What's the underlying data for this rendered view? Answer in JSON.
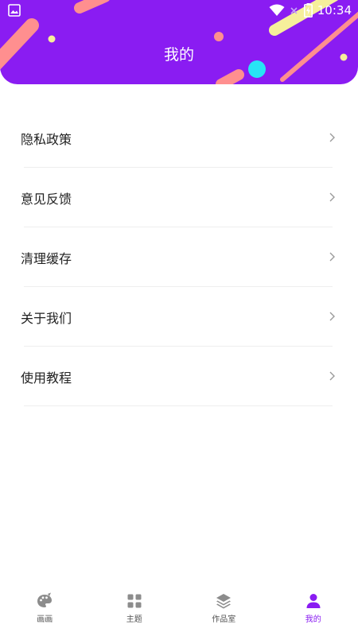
{
  "status_bar": {
    "time": "10:34"
  },
  "header": {
    "title": "我的"
  },
  "menu": {
    "items": [
      {
        "label": "隐私政策"
      },
      {
        "label": "意见反馈"
      },
      {
        "label": "清理缓存"
      },
      {
        "label": "关于我们"
      },
      {
        "label": "使用教程"
      }
    ]
  },
  "bottom_nav": {
    "items": [
      {
        "label": "画画",
        "icon": "palette-icon"
      },
      {
        "label": "主题",
        "icon": "grid-icon"
      },
      {
        "label": "作品室",
        "icon": "layers-icon"
      },
      {
        "label": "我的",
        "icon": "person-icon",
        "active": true
      }
    ]
  },
  "colors": {
    "accent": "#8a1cf2",
    "text": "#222222",
    "nav_text": "#555555"
  }
}
